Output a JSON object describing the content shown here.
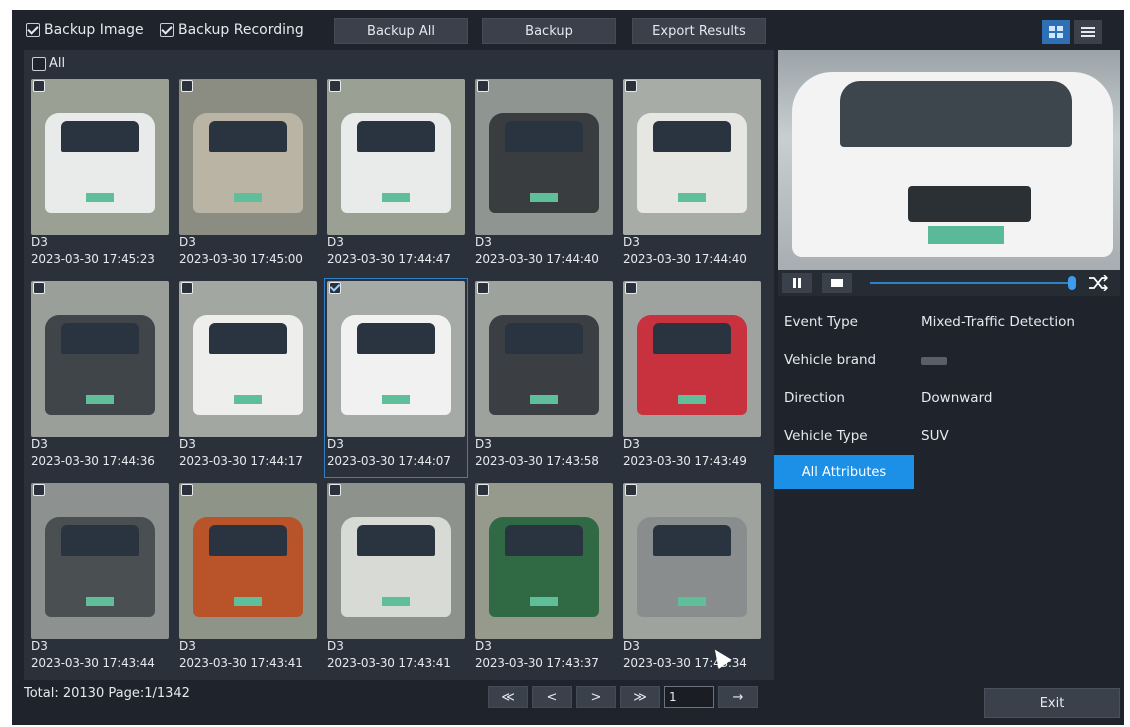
{
  "toolbar": {
    "backup_image_label": "Backup Image",
    "backup_recording_label": "Backup Recording",
    "backup_all_label": "Backup All",
    "backup_label": "Backup",
    "export_label": "Export Results"
  },
  "grid": {
    "all_label": "All",
    "items": [
      {
        "camera": "D3",
        "time": "2023-03-30 17:45:23",
        "checked": false,
        "color": "#e9ebea",
        "bg": "#9aa093"
      },
      {
        "camera": "D3",
        "time": "2023-03-30 17:45:00",
        "checked": false,
        "color": "#b9b4a4",
        "bg": "#8b8c82"
      },
      {
        "camera": "D3",
        "time": "2023-03-30 17:44:47",
        "checked": false,
        "color": "#e9ebea",
        "bg": "#9aa093"
      },
      {
        "camera": "D3",
        "time": "2023-03-30 17:44:40",
        "checked": false,
        "color": "#3a3d3f",
        "bg": "#8f9590"
      },
      {
        "camera": "D3",
        "time": "2023-03-30 17:44:40",
        "checked": false,
        "color": "#e6e7e3",
        "bg": "#a7aca6"
      },
      {
        "camera": "D3",
        "time": "2023-03-30 17:44:36",
        "checked": false,
        "color": "#3f4549",
        "bg": "#9a9f9a"
      },
      {
        "camera": "D3",
        "time": "2023-03-30 17:44:17",
        "checked": false,
        "color": "#eeefed",
        "bg": "#a3a7a2"
      },
      {
        "camera": "D3",
        "time": "2023-03-30 17:44:07",
        "checked": true,
        "color": "#f0f1f0",
        "bg": "#a5aaa6"
      },
      {
        "camera": "D3",
        "time": "2023-03-30 17:43:58",
        "checked": false,
        "color": "#3b3f43",
        "bg": "#9da29d"
      },
      {
        "camera": "D3",
        "time": "2023-03-30 17:43:49",
        "checked": false,
        "color": "#c7323e",
        "bg": "#9ea39f"
      },
      {
        "camera": "D3",
        "time": "2023-03-30 17:43:44",
        "checked": false,
        "color": "#4a4f52",
        "bg": "#8d9190"
      },
      {
        "camera": "D3",
        "time": "2023-03-30 17:43:41",
        "checked": false,
        "color": "#b9532a",
        "bg": "#8f9489"
      },
      {
        "camera": "D3",
        "time": "2023-03-30 17:43:41",
        "checked": false,
        "color": "#d8dad6",
        "bg": "#8e928c"
      },
      {
        "camera": "D3",
        "time": "2023-03-30 17:43:37",
        "checked": false,
        "color": "#2f6a45",
        "bg": "#959a8d"
      },
      {
        "camera": "D3",
        "time": "2023-03-30 17:43:34",
        "checked": false,
        "color": "#8a8d8d",
        "bg": "#9ea39e"
      }
    ]
  },
  "footer": {
    "total_text": "Total: 20130  Page:1/1342",
    "first_label": "≪",
    "prev_label": "<",
    "next_label": ">",
    "last_label": "≫",
    "page_input": "1",
    "go_label": "→"
  },
  "attributes": [
    {
      "name": "Event Type",
      "value": "Mixed-Traffic Detection"
    },
    {
      "name": "Vehicle brand",
      "value": ""
    },
    {
      "name": "Direction",
      "value": "Downward"
    },
    {
      "name": "Vehicle Type",
      "value": "SUV"
    }
  ],
  "all_attributes_label": "All Attributes",
  "exit_label": "Exit",
  "icons": {
    "grid_view": "grid-view-icon",
    "list_view": "list-view-icon",
    "pause": "pause-icon",
    "stop": "stop-icon",
    "fullscreen": "shuffle-icon"
  },
  "colors": {
    "accent": "#1c8fe6",
    "panel": "#2b313a",
    "background": "#1f242c"
  }
}
